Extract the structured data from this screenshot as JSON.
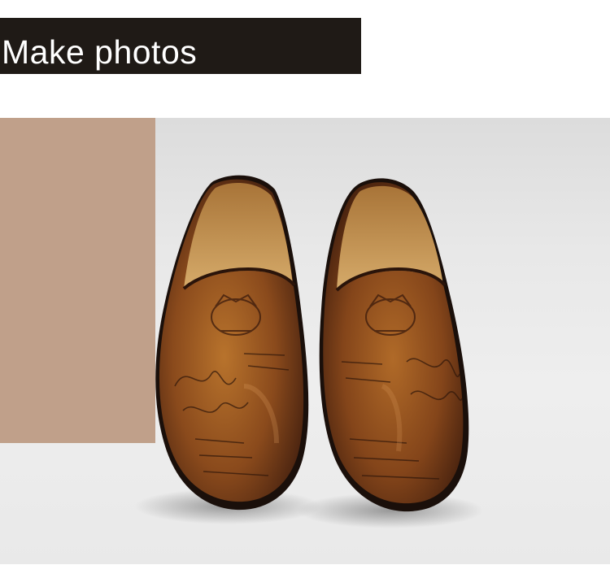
{
  "header": {
    "title": "Make photos"
  },
  "photo": {
    "subject": "shoes-image",
    "colors": {
      "accent_block": "#c0a08a",
      "leather_dark": "#4a2412",
      "leather_mid": "#8a4a1c",
      "leather_light": "#b8732c",
      "lining": "#c99a5c",
      "sole": "#1a0f0a"
    }
  }
}
